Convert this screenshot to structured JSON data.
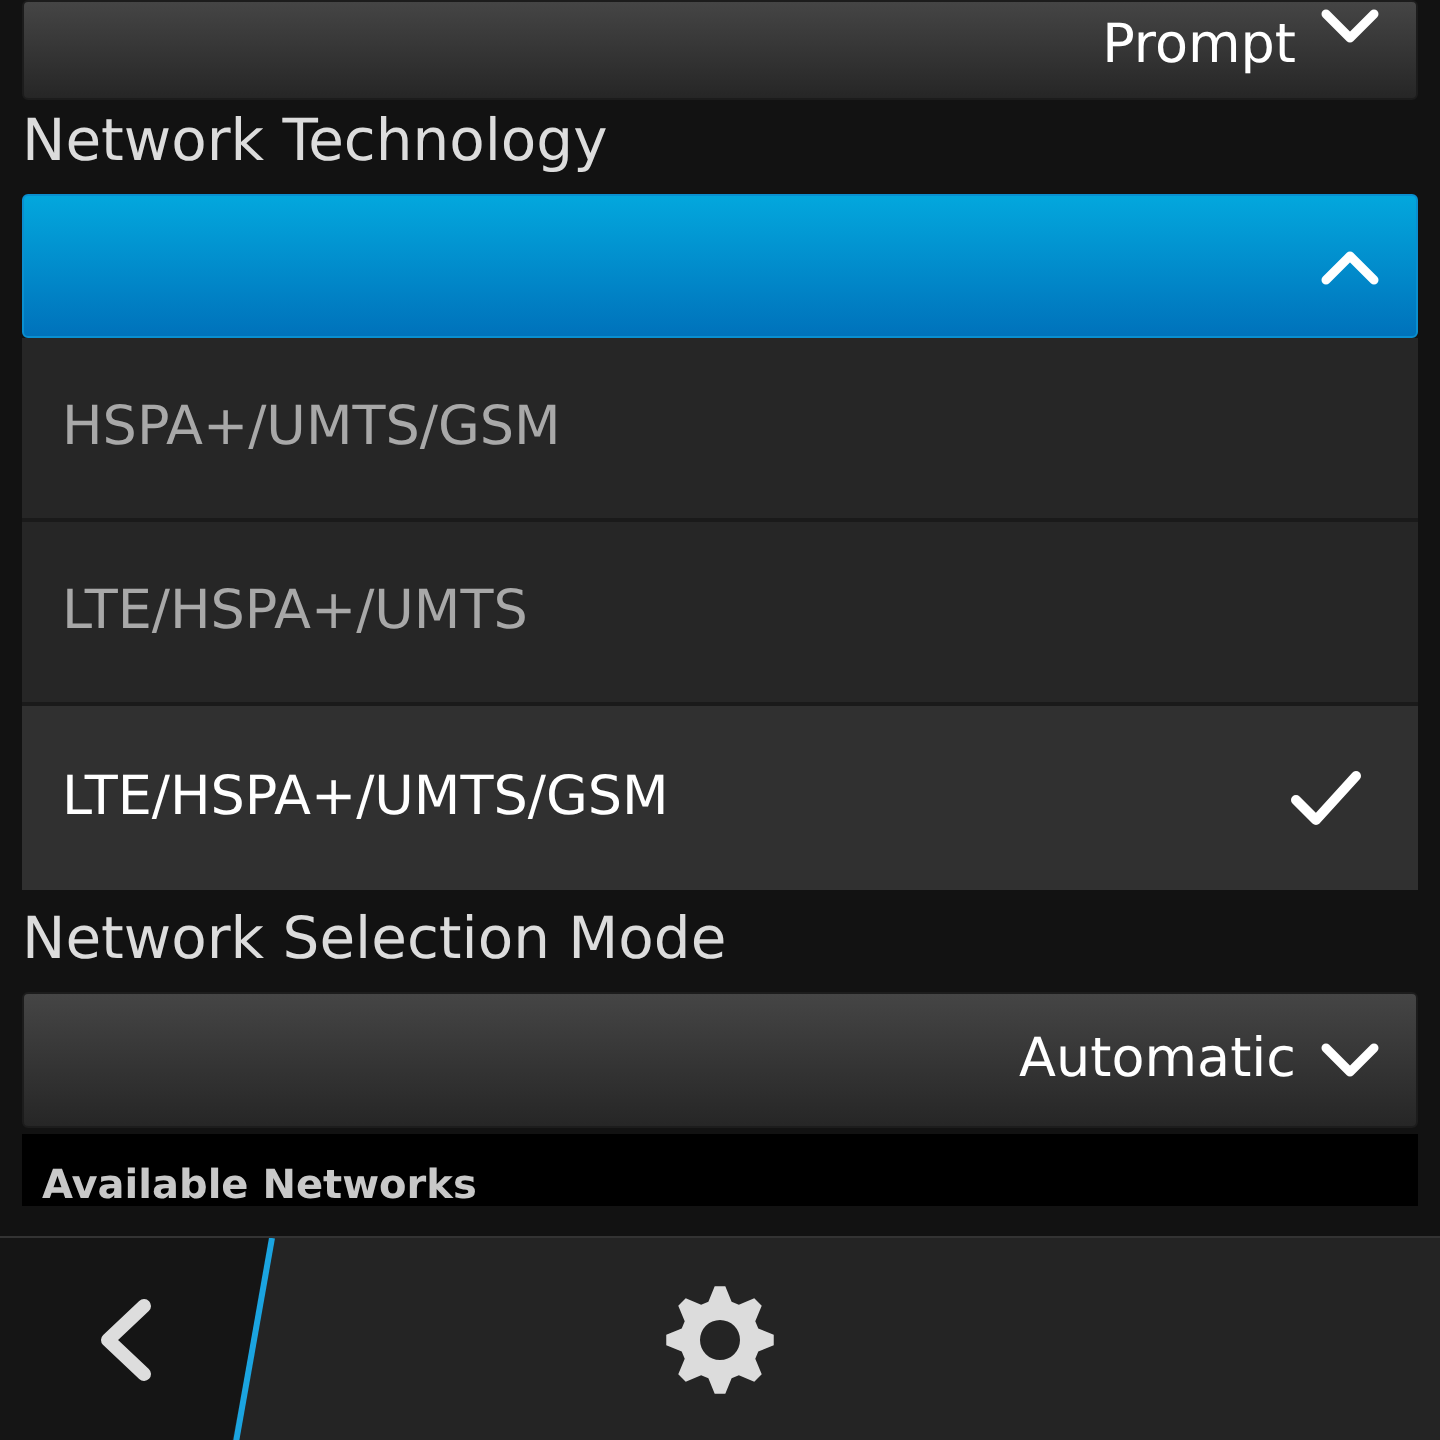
{
  "top_dropdown": {
    "value": "Prompt",
    "expanded": false
  },
  "network_technology": {
    "label": "Network Technology",
    "expanded": true,
    "options": [
      {
        "label": "HSPA+/UMTS/GSM",
        "selected": false
      },
      {
        "label": "LTE/HSPA+/UMTS",
        "selected": false
      },
      {
        "label": "LTE/HSPA+/UMTS/GSM",
        "selected": true
      }
    ]
  },
  "network_selection_mode": {
    "label": "Network Selection Mode",
    "value": "Automatic",
    "expanded": false
  },
  "available_networks": {
    "header": "Available Networks"
  }
}
